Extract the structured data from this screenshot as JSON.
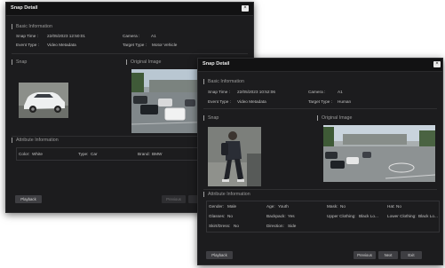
{
  "back": {
    "title": "Snap Detail",
    "close_glyph": "×",
    "basic_info_title": "Basic Information",
    "snap_time_label": "Snap Time :",
    "snap_time": "22/05/2023 12:50:01",
    "camera_label": "Camera :",
    "camera": "A1",
    "event_type_label": "Event Type :",
    "event_type": "Video Metadata",
    "target_type_label": "Target Type :",
    "target_type": "Motor Vehicle",
    "snap_title": "Snap",
    "original_title": "Original Image",
    "attr_title": "Attribute Information",
    "color_label": "Color:",
    "color": "White",
    "type_label": "Type:",
    "type": "Car",
    "brand_label": "Brand:",
    "brand": "BMW",
    "playback": "Playback",
    "previous": "Previous"
  },
  "front": {
    "title": "Snap Detail",
    "close_glyph": "×",
    "basic_info_title": "Basic Information",
    "snap_time_label": "Snap Time :",
    "snap_time": "22/05/2023 10:52:06",
    "camera_label": "Camera :",
    "camera": "A1",
    "event_type_label": "Event Type :",
    "event_type": "Video Metadata",
    "target_type_label": "Target Type :",
    "target_type": "Human",
    "snap_title": "Snap",
    "original_title": "Original Image",
    "attr_title": "Attribute Information",
    "attrs": {
      "gender_label": "Gender:",
      "gender": "Male",
      "age_label": "Age:",
      "age": "Youth",
      "mask_label": "Mask:",
      "mask": "No",
      "hat_label": "Hat:",
      "hat": "No",
      "glasses_label": "Glasses:",
      "glasses": "No",
      "backpack_label": "Backpack:",
      "backpack": "Yes",
      "upper_label": "Upper Clothing:",
      "upper": "Black Lo...",
      "lower_label": "Lower Clothing:",
      "lower": "Black Lo...",
      "skirt_label": "Skirt/Dress:",
      "skirt": "No",
      "direction_label": "Direction:",
      "direction": "Side"
    },
    "playback": "Playback",
    "previous": "Previous",
    "next": "Next",
    "exit": "Exit"
  },
  "colors": {
    "window_bg": "#1c1c1e",
    "titlebar_bg": "#121213",
    "text": "#c8c8c8",
    "button_bg": "#3e3e42"
  }
}
